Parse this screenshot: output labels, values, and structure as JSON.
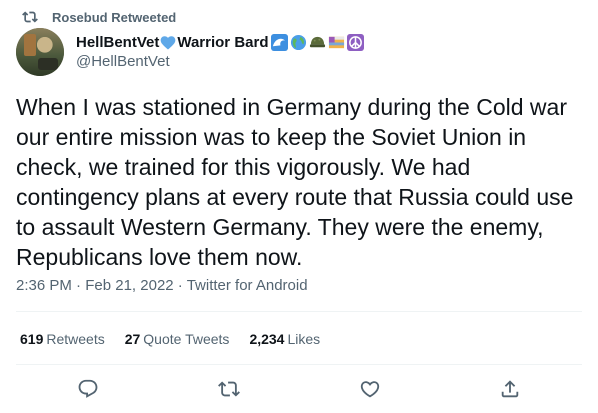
{
  "retweet_context": {
    "label": "Rosebud Retweeted",
    "icon": "retweet-icon"
  },
  "author": {
    "display_name": "HellBentVet",
    "display_name_suffix": "Warrior Bard",
    "handle": "@HellBentVet",
    "emojis": [
      "heart-icon",
      "wave-icon",
      "globe-icon",
      "helmet-icon",
      "flag-icon",
      "peace-icon"
    ]
  },
  "tweet": {
    "text": "When I was stationed in Germany during the Cold war our entire mission was to keep the Soviet Union in check, we trained for this vigorously. We had contingency plans at every route that Russia could use to assault Western Germany. They were the enemy, Republicans love them now."
  },
  "meta": {
    "time": "2:36 PM",
    "separator": " · ",
    "date": "Feb 21, 2022",
    "client": "Twitter for Android"
  },
  "stats": {
    "retweets": {
      "count": "619",
      "label": "Retweets"
    },
    "quote_tweets": {
      "count": "27",
      "label": "Quote Tweets"
    },
    "likes": {
      "count": "2,234",
      "label": "Likes"
    }
  },
  "colors": {
    "text": "#0f1419",
    "secondary": "#536471",
    "divider": "#eff3f4",
    "heart_blue": "#5fa8e8"
  }
}
